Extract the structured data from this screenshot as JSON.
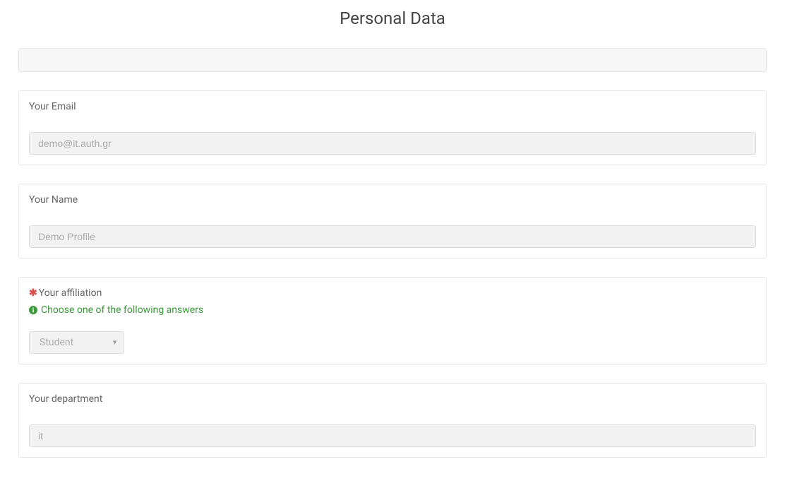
{
  "page": {
    "title": "Personal Data"
  },
  "fields": {
    "email": {
      "label": "Your Email",
      "value": "demo@it.auth.gr"
    },
    "name": {
      "label": "Your Name",
      "value": "Demo Profile"
    },
    "affiliation": {
      "label": "Your affiliation",
      "required": true,
      "helper": "Choose one of the following answers",
      "value": "Student"
    },
    "department": {
      "label": "Your department",
      "value": "it"
    }
  }
}
